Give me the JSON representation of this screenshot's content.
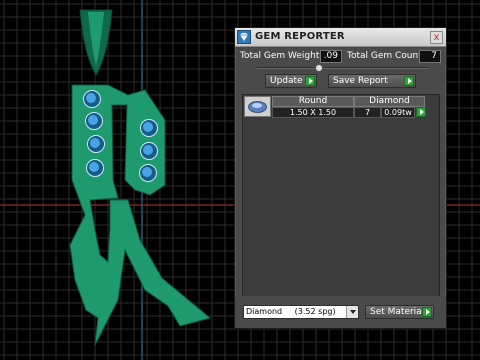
{
  "colors": {
    "gem_body": "#1f9a6f",
    "gem_stone": "#4aa3e6",
    "grid": "#2d2d2d",
    "axis_blue": "#2e6f8f",
    "axis_red": "#8f2a2a",
    "accent_go": "#2fa33a"
  },
  "dialog": {
    "title": "GEM REPORTER",
    "icon": "gem-reporter-app-icon",
    "close_glyph": "x"
  },
  "stats": {
    "weight_label": "Total Gem Weight",
    "weight_value": ".09",
    "count_label": "Total Gem Count",
    "count_value": "7"
  },
  "actions": {
    "update_label": "Update",
    "save_report_label": "Save Report"
  },
  "table": {
    "headers": [
      "Round",
      "Diamond"
    ],
    "row": {
      "size": "1.50 X 1.50",
      "count": "7",
      "weight": "0.09tw"
    }
  },
  "material": {
    "selected": "Diamond",
    "gravity": "(3.52 spg)",
    "set_label": "Set Material"
  }
}
